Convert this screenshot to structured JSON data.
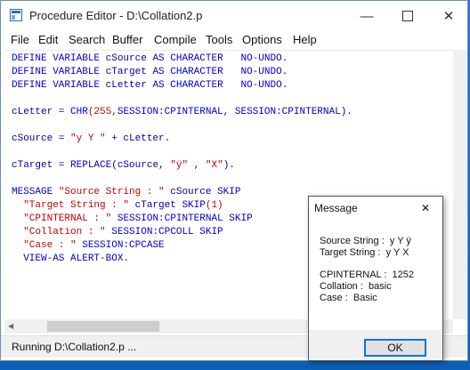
{
  "window": {
    "title": "Procedure Editor - D:\\Collation2.p",
    "minimize_icon": "minimize-icon",
    "maximize_icon": "maximize-icon",
    "close_icon": "close-icon"
  },
  "menu": [
    "File",
    "Edit",
    "Search",
    "Buffer",
    "Compile",
    "Tools",
    "Options",
    "Help"
  ],
  "code": {
    "l1": {
      "a": "DEFINE VARIABLE",
      "b": " cSource ",
      "c": "AS CHARACTER",
      "d": "   ",
      "e": "NO-UNDO",
      "f": "."
    },
    "l2": {
      "a": "DEFINE VARIABLE",
      "b": " cTarget ",
      "c": "AS CHARACTER",
      "d": "   ",
      "e": "NO-UNDO",
      "f": "."
    },
    "l3": {
      "a": "DEFINE VARIABLE",
      "b": " cLetter ",
      "c": "AS CHARACTER",
      "d": "   ",
      "e": "NO-UNDO",
      "f": "."
    },
    "l4": {
      "a": "cLetter = ",
      "b": "CHR",
      "c": "(255,",
      "d": "SESSION:CPINTERNAL",
      "e": ", ",
      "f": "SESSION:CPINTERNAL",
      "g": ")."
    },
    "l5": {
      "a": "cSource = ",
      "b": "\"y Y \"",
      "c": " + cLetter."
    },
    "l6": {
      "a": "cTarget = ",
      "b": "REPLACE",
      "c": "(cSource, ",
      "d": "\"ÿ\"",
      "e": " , ",
      "f": "\"X\"",
      "g": ")."
    },
    "l7": {
      "a": "MESSAGE ",
      "b": "\"Source String : \"",
      "c": " cSource ",
      "d": "SKIP"
    },
    "l8": {
      "a": "  ",
      "b": "\"Target String : \"",
      "c": " cTarget ",
      "d": "SKIP",
      "e": "(1)"
    },
    "l9": {
      "a": "  ",
      "b": "\"CPINTERNAL : \"",
      "c": " ",
      "d": "SESSION:CPINTERNAL SKIP"
    },
    "l10": {
      "a": "  ",
      "b": "\"Collation : \"",
      "c": " ",
      "d": "SESSION:CPCOLL SKIP"
    },
    "l11": {
      "a": "  ",
      "b": "\"Case : \"",
      "c": " ",
      "d": "SESSION:CPCASE"
    },
    "l12": {
      "a": "  ",
      "b": "VIEW-AS ALERT-BOX",
      "c": "."
    }
  },
  "status": "Running D:\\Collation2.p ...",
  "dialog": {
    "title": "Message",
    "lines": [
      "Source String :  y Y ÿ",
      "Target String :  y Y X",
      "CPINTERNAL :  1252",
      "Collation :  basic",
      "Case :  Basic"
    ],
    "ok_label": "OK"
  },
  "colors": {
    "keyword": "#0000d0",
    "string": "#c00000",
    "accent": "#0078d7"
  }
}
